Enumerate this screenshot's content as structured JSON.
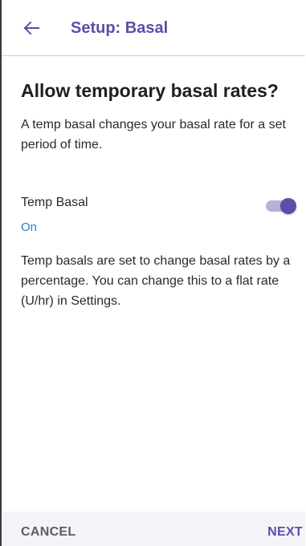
{
  "app_bar": {
    "title": "Setup: Basal",
    "back_icon": "arrow-left-icon"
  },
  "content": {
    "heading": "Allow temporary basal rates?",
    "intro": "A temp basal changes your basal rate for a set period of time."
  },
  "setting": {
    "label": "Temp Basal",
    "value": "On",
    "enabled": true
  },
  "note": "Temp basals are set to change basal rates by a percentage. You can change this to a flat rate (U/hr) in Settings.",
  "footer": {
    "cancel_label": "CANCEL",
    "next_label": "NEXT"
  },
  "colors": {
    "accent": "#5b4ea8",
    "accent_light": "#b9afd9",
    "value_blue": "#2f80c9",
    "footer_bg": "#f2f4f8"
  }
}
